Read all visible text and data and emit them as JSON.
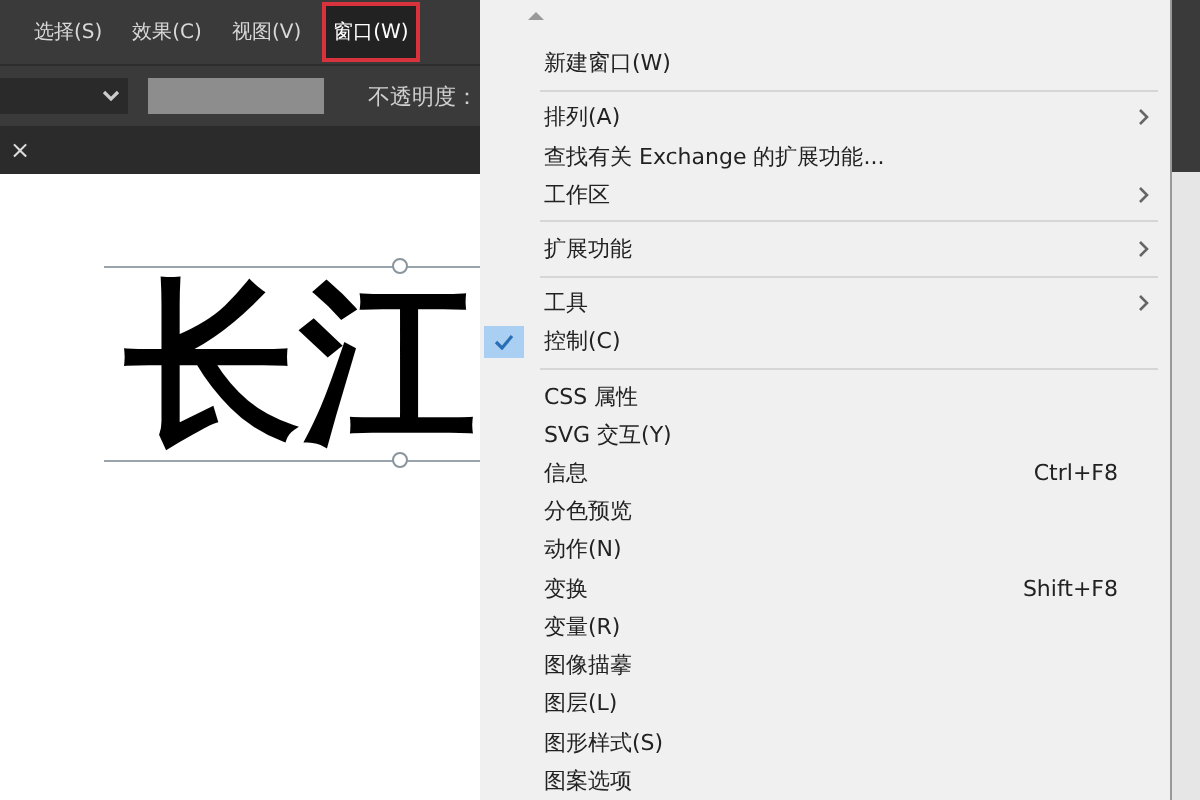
{
  "menubar": {
    "items": [
      {
        "label": "选择(S)",
        "selected": false
      },
      {
        "label": "效果(C)",
        "selected": false
      },
      {
        "label": "视图(V)",
        "selected": false
      },
      {
        "label": "窗口(W)",
        "selected": true
      }
    ]
  },
  "control_bar": {
    "opacity_label": "不透明度："
  },
  "document_tab": {
    "close": "×"
  },
  "canvas": {
    "text": "长江",
    "selected": true
  },
  "menu": {
    "items": [
      {
        "kind": "item",
        "label": "新建窗口(W)",
        "checked": false,
        "submenu": false
      },
      {
        "kind": "separator"
      },
      {
        "kind": "item",
        "label": "排列(A)",
        "checked": false,
        "submenu": true
      },
      {
        "kind": "item",
        "label": "查找有关 Exchange 的扩展功能...",
        "checked": false,
        "submenu": false
      },
      {
        "kind": "item",
        "label": "工作区",
        "checked": false,
        "submenu": true
      },
      {
        "kind": "separator"
      },
      {
        "kind": "item",
        "label": "扩展功能",
        "checked": false,
        "submenu": true
      },
      {
        "kind": "separator"
      },
      {
        "kind": "item",
        "label": "工具",
        "checked": false,
        "submenu": true
      },
      {
        "kind": "item",
        "label": "控制(C)",
        "checked": true,
        "submenu": false
      },
      {
        "kind": "separator"
      },
      {
        "kind": "item",
        "label": "CSS 属性",
        "checked": false,
        "submenu": false
      },
      {
        "kind": "item",
        "label": "SVG 交互(Y)",
        "checked": false,
        "submenu": false
      },
      {
        "kind": "item",
        "label": "信息",
        "shortcut": "Ctrl+F8",
        "checked": false,
        "submenu": false
      },
      {
        "kind": "item",
        "label": "分色预览",
        "checked": false,
        "submenu": false
      },
      {
        "kind": "item",
        "label": "动作(N)",
        "checked": false,
        "submenu": false
      },
      {
        "kind": "item",
        "label": "变换",
        "shortcut": "Shift+F8",
        "checked": false,
        "submenu": false
      },
      {
        "kind": "item",
        "label": "变量(R)",
        "checked": false,
        "submenu": false
      },
      {
        "kind": "item",
        "label": "图像描摹",
        "checked": false,
        "submenu": false
      },
      {
        "kind": "item",
        "label": "图层(L)",
        "checked": false,
        "submenu": false
      },
      {
        "kind": "item",
        "label": "图形样式(S)",
        "checked": false,
        "submenu": false
      },
      {
        "kind": "item",
        "label": "图案选项",
        "checked": false,
        "submenu": false
      }
    ]
  }
}
